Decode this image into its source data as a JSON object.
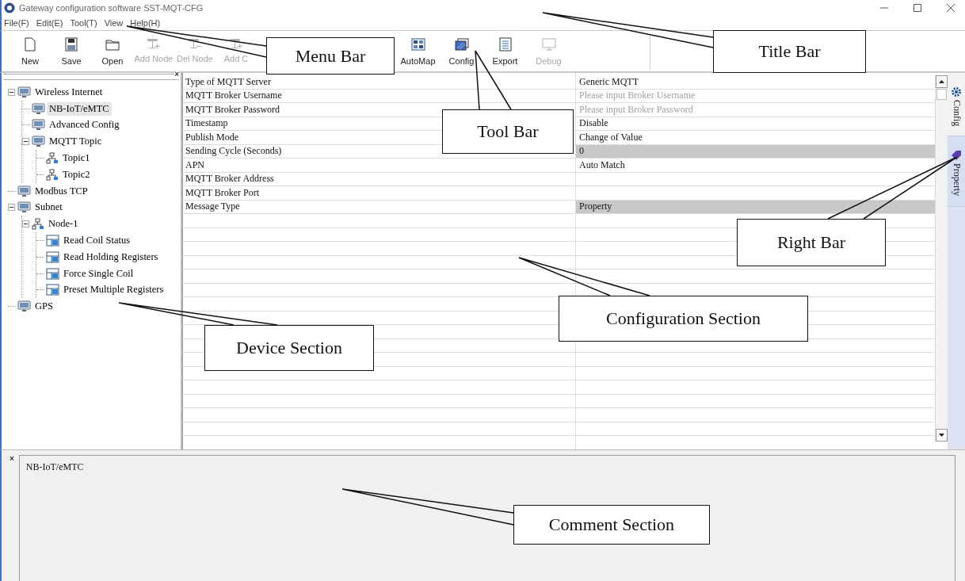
{
  "window": {
    "title": "Gateway configuration software SST-MQT-CFG"
  },
  "menu": [
    {
      "label": "File(F)"
    },
    {
      "label": "Edit(E)"
    },
    {
      "label": "Tool(T)"
    },
    {
      "label": "View"
    },
    {
      "label": "Help(H)"
    }
  ],
  "toolbar_left": [
    {
      "label": "New",
      "kind": "new",
      "disabled": false
    },
    {
      "label": "Save",
      "kind": "save",
      "disabled": false
    },
    {
      "label": "Open",
      "kind": "open",
      "disabled": false
    },
    {
      "label": "Add Node",
      "kind": "addnode",
      "disabled": true
    },
    {
      "label": "Del Node",
      "kind": "delnode",
      "disabled": true
    },
    {
      "label": "Add C",
      "kind": "addnode",
      "disabled": true
    }
  ],
  "toolbar_right": [
    {
      "label": "AutoMap",
      "kind": "automap",
      "disabled": false
    },
    {
      "label": "Config",
      "kind": "config",
      "disabled": false
    },
    {
      "label": "Export",
      "kind": "export",
      "disabled": false
    },
    {
      "label": "Debug",
      "kind": "debug",
      "disabled": true
    }
  ],
  "tree": [
    {
      "label": "Wireless Internet",
      "kind": "device",
      "selected": false,
      "expanded": true,
      "children": [
        {
          "label": "NB-IoT/eMTC",
          "kind": "device",
          "selected": true
        },
        {
          "label": "Advanced Config",
          "kind": "device",
          "selected": false
        },
        {
          "label": "MQTT Topic",
          "kind": "device",
          "selected": false,
          "expanded": true,
          "children": [
            {
              "label": "Topic1",
              "kind": "node",
              "selected": false
            },
            {
              "label": "Topic2",
              "kind": "node",
              "selected": false
            }
          ]
        }
      ]
    },
    {
      "label": "Modbus TCP",
      "kind": "device",
      "selected": false
    },
    {
      "label": "Subnet",
      "kind": "device",
      "selected": false,
      "expanded": true,
      "children": [
        {
          "label": "Node-1",
          "kind": "node",
          "selected": false,
          "expanded": true,
          "children": [
            {
              "label": "Read Coil Status",
              "kind": "command",
              "selected": false
            },
            {
              "label": "Read Holding Registers",
              "kind": "command",
              "selected": false
            },
            {
              "label": "Force Single Coil",
              "kind": "command",
              "selected": false
            },
            {
              "label": "Preset Multiple Registers",
              "kind": "command",
              "selected": false
            }
          ]
        }
      ]
    },
    {
      "label": "GPS",
      "kind": "device",
      "selected": false
    }
  ],
  "properties": [
    {
      "name": "Type of MQTT Server",
      "value": "Generic MQTT",
      "highlighted": false
    },
    {
      "name": "MQTT Broker Username",
      "placeholder": "Please input Broker Username",
      "highlighted": false
    },
    {
      "name": "MQTT Broker Password",
      "placeholder": "Please input Broker Password",
      "highlighted": false
    },
    {
      "name": "Timestamp",
      "value": "Disable",
      "highlighted": false
    },
    {
      "name": "Publish Mode",
      "value": "Change of Value",
      "highlighted": false
    },
    {
      "name": "Sending Cycle (Seconds)",
      "value": "0",
      "highlighted": true
    },
    {
      "name": "APN",
      "value": "Auto Match",
      "highlighted": false
    },
    {
      "name": "MQTT Broker Address",
      "highlighted": false
    },
    {
      "name": "MQTT Broker Port",
      "highlighted": false
    },
    {
      "name": "Message Type",
      "value": "Property",
      "highlighted": true
    }
  ],
  "right_bar": [
    {
      "label": "Config",
      "kind": "gear",
      "selected": true
    },
    {
      "label": "Property",
      "kind": "tag",
      "selected": false
    }
  ],
  "tree_panel": {
    "close": "×"
  },
  "comment": {
    "close": "×",
    "text": "NB-IoT/eMTC"
  },
  "callouts": [
    {
      "label": "Menu Bar"
    },
    {
      "label": "Title Bar"
    },
    {
      "label": "Tool Bar"
    },
    {
      "label": "Right Bar"
    },
    {
      "label": "Configuration Section"
    },
    {
      "label": "Device Section"
    },
    {
      "label": "Comment Section"
    }
  ]
}
